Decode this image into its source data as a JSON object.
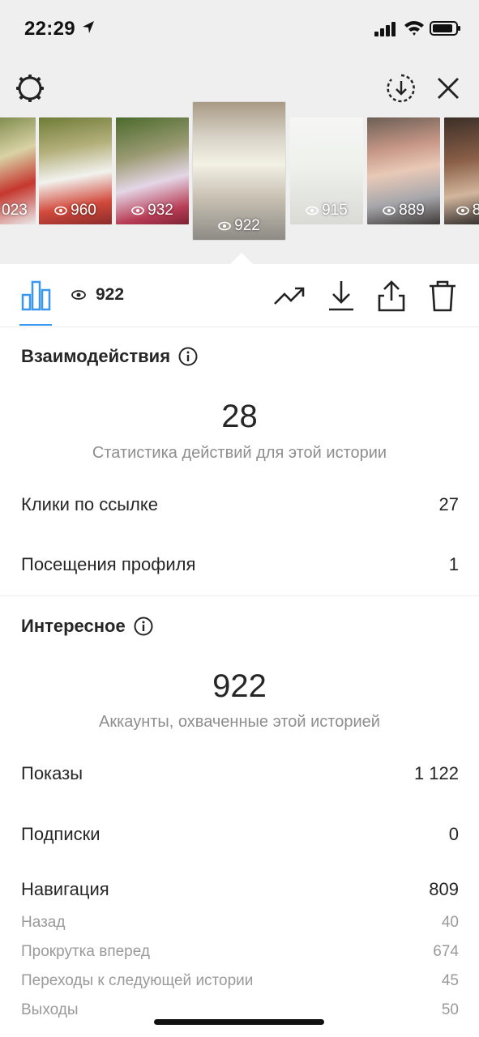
{
  "status_bar": {
    "time": "22:29"
  },
  "strip": {
    "thumbnails": [
      {
        "views": "023"
      },
      {
        "views": "960"
      },
      {
        "views": "932"
      },
      {
        "views": "922",
        "selected": true
      },
      {
        "views": "915"
      },
      {
        "views": "889"
      },
      {
        "views": "8"
      }
    ]
  },
  "toolbar": {
    "views": "922"
  },
  "interactions": {
    "title": "Взаимодействия",
    "total": "28",
    "caption": "Статистика действий для этой истории",
    "rows": [
      {
        "label": "Клики по ссылке",
        "value": "27"
      },
      {
        "label": "Посещения профиля",
        "value": "1"
      }
    ]
  },
  "discovery": {
    "title": "Интересное",
    "total": "922",
    "caption": "Аккаунты, охваченные этой историей",
    "rows": [
      {
        "label": "Показы",
        "value": "1 122"
      },
      {
        "label": "Подписки",
        "value": "0"
      },
      {
        "label": "Навигация",
        "value": "809"
      }
    ],
    "navigation_details": [
      {
        "label": "Назад",
        "value": "40"
      },
      {
        "label": "Прокрутка вперед",
        "value": "674"
      },
      {
        "label": "Переходы к следующей истории",
        "value": "45"
      },
      {
        "label": "Выходы",
        "value": "50"
      }
    ]
  },
  "colors": {
    "accent": "#3897f0",
    "text": "#262626",
    "muted": "#8e8e8e"
  }
}
